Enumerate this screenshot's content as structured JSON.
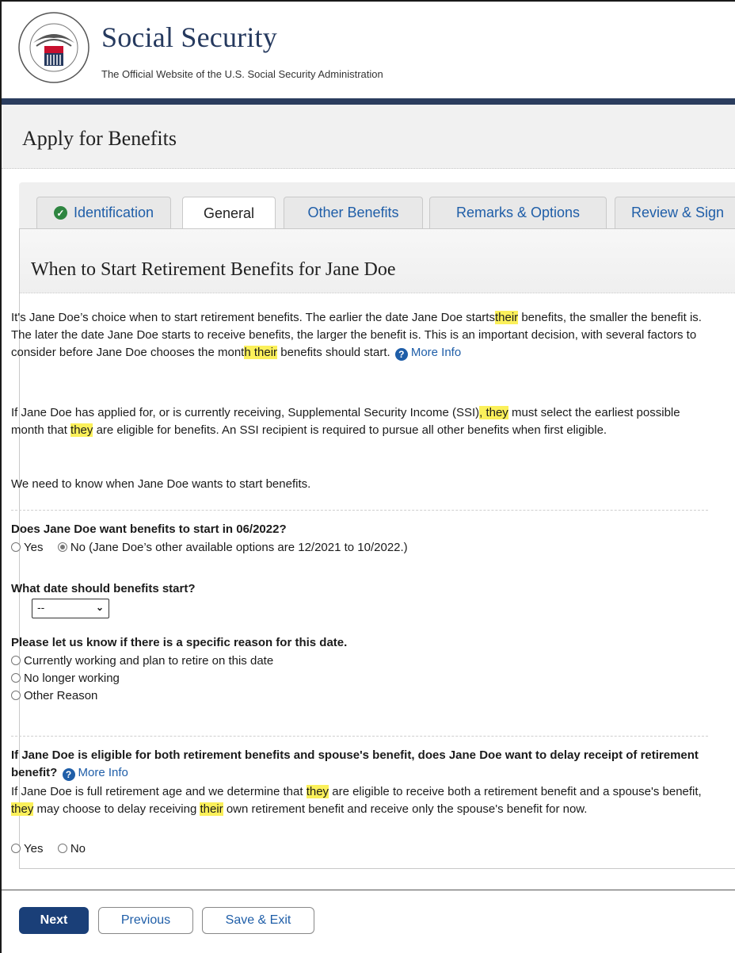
{
  "header": {
    "site_title": "Social Security",
    "site_subtitle": "The Official Website of the U.S. Social Security Administration",
    "seal_text": "SOCIAL SECURITY ADMINISTRATION USA"
  },
  "page_title": "Apply for Benefits",
  "tabs": [
    {
      "label": "Identification",
      "state": "completed"
    },
    {
      "label": "General",
      "state": "active"
    },
    {
      "label": "Other Benefits",
      "state": "link"
    },
    {
      "label": "Remarks & Options",
      "state": "link"
    },
    {
      "label": "Review & Sign",
      "state": "link"
    }
  ],
  "section": {
    "title": "When to Start Retirement Benefits for Jane Doe",
    "para1": {
      "a": "It's Jane Doe’s choice when to start retirement benefits. The earlier the date Jane Doe starts",
      "hl1": "their",
      "b": " benefits, the smaller the benefit is. The later the date Jane Doe starts to receive benefits, the larger the benefit is. This is an important decision, with several factors to consider before Jane Doe chooses the mont",
      "hl2": "h their",
      "c": "benefits should start.",
      "more_info": "More Info"
    },
    "para2": {
      "a": "If Jane Doe has applied for, or is currently receiving, Supplemental Security Income (SSI)",
      "hl1": ", they",
      "b": " must select the earliest possible month that ",
      "hl2": "they",
      "c": " are eligible for benefits. An SSI recipient is required to pursue all other benefits when first eligible."
    },
    "para3": "We need to know when Jane Doe wants to start benefits.",
    "q1": {
      "question": "Does Jane Doe want benefits to start in 06/2022?",
      "opt_yes": "Yes",
      "opt_no": "No (Jane Doe’s other available options are 12/2021 to 10/2022.)",
      "selected": "No"
    },
    "q2": {
      "question": "What date should benefits start?",
      "select_value": "--"
    },
    "q3": {
      "question": "Please let us know if there is a specific reason for this date.",
      "options": [
        "Currently working and plan to retire on this date",
        "No longer working",
        "Other Reason"
      ]
    },
    "q4": {
      "question": "If Jane Doe is eligible for both retirement benefits and spouse's benefit, does Jane Doe want to delay receipt of retirement benefit?",
      "more_info": "More Info",
      "desc_a": "If Jane Doe is full retirement age and we determine that ",
      "desc_hl1": "they",
      "desc_b": " are eligible to receive both a retirement benefit and a spouse's benefit, ",
      "desc_hl2": "they",
      "desc_c": " may choose to delay receiving ",
      "desc_hl3": "their",
      "desc_d": " own retirement benefit and receive only the spouse's benefit for now.",
      "opt_yes": "Yes",
      "opt_no": "No"
    }
  },
  "buttons": {
    "next": "Next",
    "previous": "Previous",
    "save_exit": "Save & Exit"
  },
  "colors": {
    "brand_navy": "#25395e",
    "highlight": "#fbf05a",
    "link": "#1f5ea8",
    "primary_button": "#1a3f78",
    "check_green": "#2e8540"
  }
}
